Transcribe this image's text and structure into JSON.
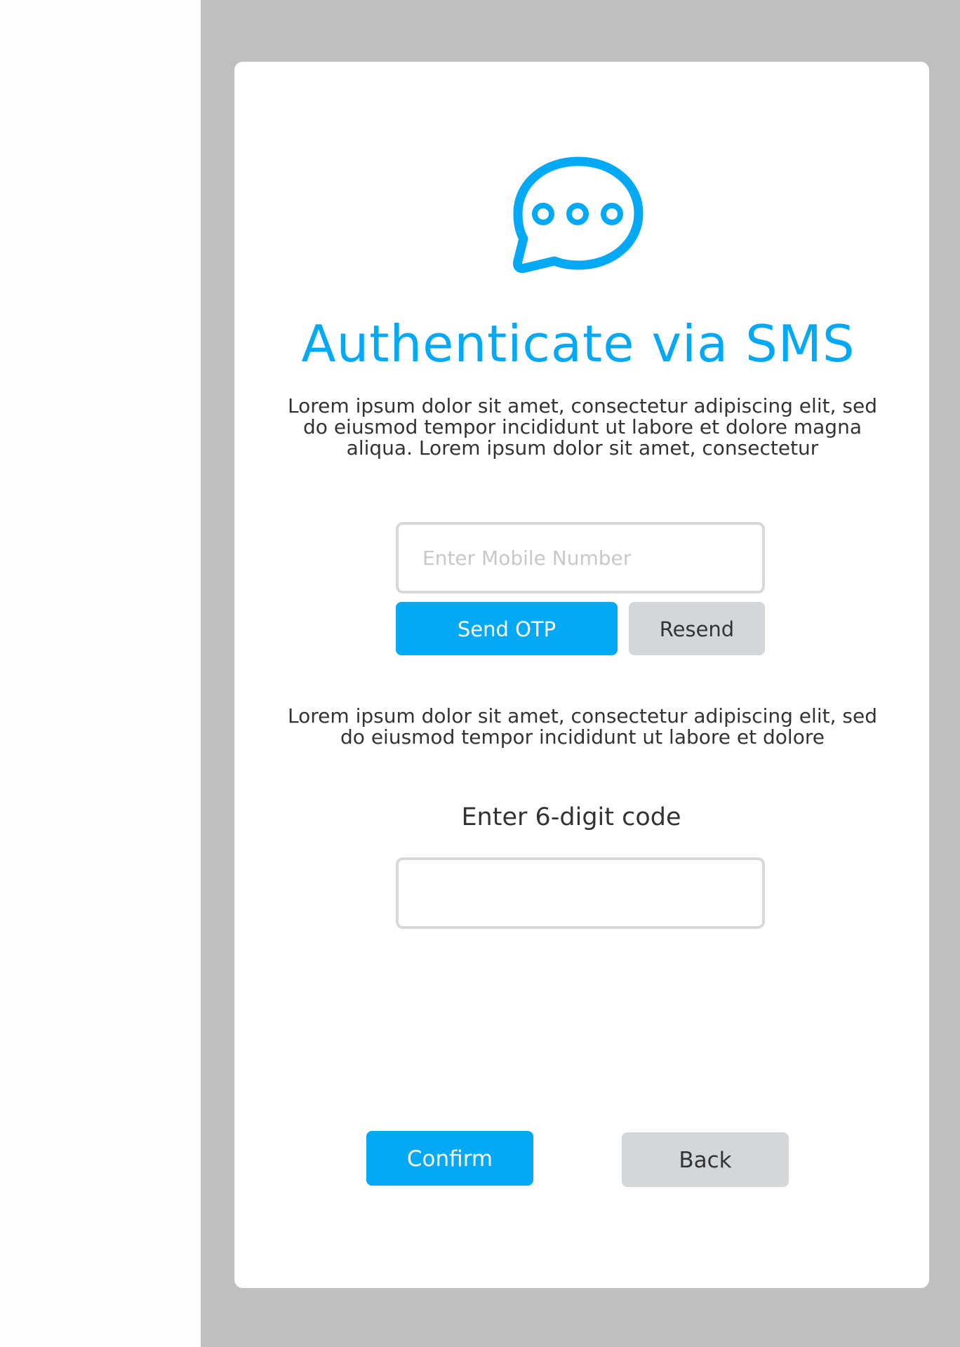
{
  "colors": {
    "accent": "#03a9f4",
    "backdrop": "#bfbfbf",
    "secondary_button": "#d4d7da",
    "text": "#333333"
  },
  "header": {
    "icon": "chat-bubble-dots-icon",
    "title": "Authenticate via SMS",
    "description": "Lorem ipsum dolor sit amet, consectetur adipiscing elit, sed do eiusmod tempor incididunt ut labore et dolore magna aliqua. Lorem ipsum dolor sit amet, consectetur"
  },
  "mobile": {
    "placeholder": "Enter Mobile Number",
    "value": "",
    "send_label": "Send OTP",
    "resend_label": "Resend"
  },
  "otp": {
    "description": "Lorem ipsum dolor sit amet, consectetur adipiscing elit, sed do eiusmod tempor incididunt ut labore et dolore",
    "label": "Enter 6-digit code",
    "value": ""
  },
  "actions": {
    "confirm_label": "Confirm",
    "back_label": "Back"
  }
}
